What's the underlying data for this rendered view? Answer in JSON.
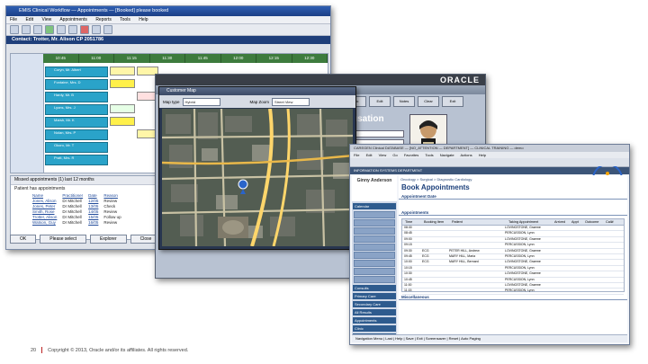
{
  "win1": {
    "title": "EMIS Clinical Workflow — Appointments — [Booked] please booked",
    "menu": [
      "File",
      "Edit",
      "View",
      "Appointments",
      "Reports",
      "Tools",
      "Help"
    ],
    "contact_title": "Contact: Trotter, Mr. Alison CP 2051786",
    "schedule_headers": [
      "10:45",
      "11:00",
      "11:15",
      "11:30",
      "11:45",
      "12:00",
      "12:15",
      "12:30"
    ],
    "row_labels": [
      "Coryn, Mr. Albert",
      "Fontaine, Mrs. D",
      "Hardy, Mr. B",
      "Lyons, Mrs. J",
      "Marsh, Mr. K",
      "Nolan, Mrs. P",
      "Okoro, Mr. T",
      "Pratt, Mrs. R"
    ],
    "list_header": "Missed appointments (1) last 12 months",
    "list_sub": "Patient has appointments",
    "columns": [
      "Name",
      "Practitioner",
      "Date",
      "Reason"
    ],
    "rows": [
      [
        "Jones, Alison",
        "Dr Mitchell",
        "12/05",
        "Review"
      ],
      [
        "Jones, Peter",
        "Dr Mitchell",
        "13/05",
        "Check"
      ],
      [
        "Smith, Rose",
        "Dr Mitchell",
        "14/05",
        "Review"
      ],
      [
        "Trotter, Alison",
        "Dr Mitchell",
        "15/05",
        "Follow up"
      ],
      [
        "Watson, Guy",
        "Dr Mitchell",
        "16/05",
        "Review"
      ]
    ],
    "buttons": [
      "OK",
      "Please select",
      "Explorer",
      "Close"
    ]
  },
  "win2": {
    "logo": "ORACLE",
    "title": "Window",
    "heading": "usation",
    "toolbar": [
      "Info",
      "Edit",
      "Notes",
      "Clear",
      "Exit"
    ]
  },
  "mapwin": {
    "title": "Customer Map",
    "ctl_label_1": "Map type",
    "ctl_label_2": "Map Zoom",
    "sel_1": "Hybrid",
    "sel_2": "Street View"
  },
  "win3": {
    "title": "CAREGEN Clinical DATABASE — [NO_ATTENTION — DEPARTMENT] — CLINICAL TRAINING — demo",
    "menu": [
      "File",
      "Edit",
      "View",
      "Go",
      "Favorites",
      "Tools",
      "Navigate",
      "Actions",
      "Help"
    ],
    "banner": "INFORMATION SYSTEMS DEPARTMENT",
    "logo": "oasis",
    "patient_name": "Ginny Anderson",
    "side_items": [
      "Calendar",
      "Book Appointments",
      "Appointments",
      "Patient Details",
      "Clinical Notes",
      "Results",
      "Orders",
      "Referrals",
      "Letters",
      "Billing"
    ],
    "side_heads": [
      "Consults",
      "Primary Care",
      "Secondary Care",
      "All Results",
      "Appointments",
      "Clinic",
      "Functions"
    ],
    "breadcrumb": "Oncology > Surgical > Diagnostic Cardiology",
    "heading": "Book Appointments",
    "sec1": "Appointment Date",
    "sec2": "Appointments",
    "sec3": "Miscellaneous",
    "grid_cols": [
      "Time",
      "Booking Item",
      "Patient",
      "Taking Appointment",
      "Arrived",
      "Appt",
      "Outcome",
      "Call#"
    ],
    "grid_rows": [
      [
        "08:30",
        "",
        "",
        "LOVINGSTONE, Graeme"
      ],
      [
        "08:45",
        "",
        "",
        "PERCUSSION, Lynn"
      ],
      [
        "09:00",
        "",
        "",
        "LOVINGSTONE, Graeme"
      ],
      [
        "09:15",
        "",
        "",
        "PERCUSSION, Lynn"
      ],
      [
        "09:30",
        "ECG",
        "PETER HILL, Andrew",
        "LOVINGSTONE, Graeme"
      ],
      [
        "09:45",
        "ECG",
        "MARY HILL, Maria",
        "PERCUSSION, Lynn"
      ],
      [
        "10:00",
        "ECG",
        "MARY HILL, Bernard",
        "LOVINGSTONE, Graeme"
      ],
      [
        "10:15",
        "",
        "",
        "PERCUSSION, Lynn"
      ],
      [
        "10:30",
        "",
        "",
        "LOVINGSTONE, Graeme"
      ],
      [
        "10:45",
        "",
        "",
        "PERCUSSION, Lynn"
      ],
      [
        "11:00",
        "",
        "",
        "LOVINGSTONE, Graeme"
      ],
      [
        "11:15",
        "",
        "",
        "PERCUSSION, Lynn"
      ]
    ],
    "bottombar": "Navigation Menu | Last | Help | Save | Exit | Screensaver | Reset | Auto Paging"
  },
  "footer": {
    "page": "20",
    "copyright": "Copyright © 2013, Oracle and/or its affiliates. All rights reserved."
  }
}
